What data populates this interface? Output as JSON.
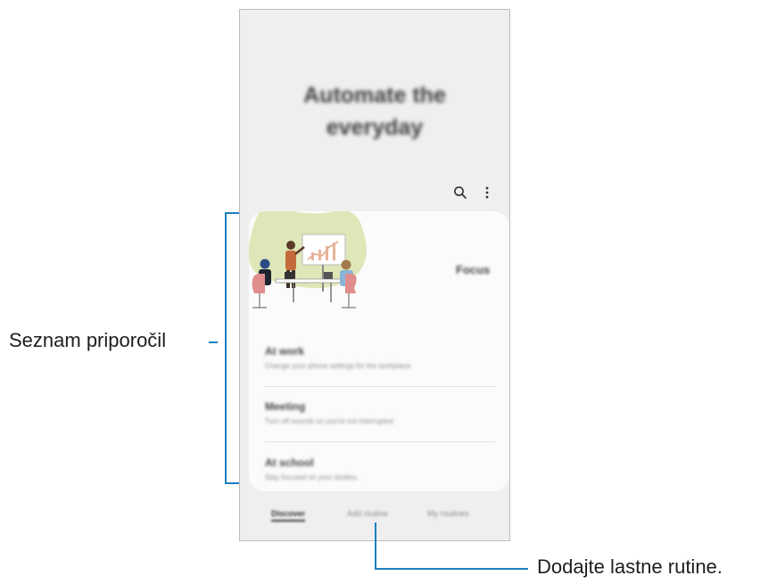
{
  "hero": {
    "line1": "Automate the",
    "line2": "everyday"
  },
  "toolbar": {
    "search_icon": "search-icon",
    "more_icon": "more-vertical-icon"
  },
  "card": {
    "focus_label": "Focus",
    "items": [
      {
        "title": "At work",
        "desc": "Change your phone settings for the workplace."
      },
      {
        "title": "Meeting",
        "desc": "Turn off sounds so you're not interrupted."
      },
      {
        "title": "At school",
        "desc": "Stay focused on your studies."
      }
    ]
  },
  "tabs": {
    "discover": "Discover",
    "add": "Add routine",
    "my": "My routines"
  },
  "callouts": {
    "recommendations": "Seznam priporočil",
    "add_routines": "Dodajte lastne rutine."
  },
  "colors": {
    "leader_line": "#1a7fc0",
    "screen_bg": "#efefef",
    "card_bg": "#fbfbfb"
  }
}
